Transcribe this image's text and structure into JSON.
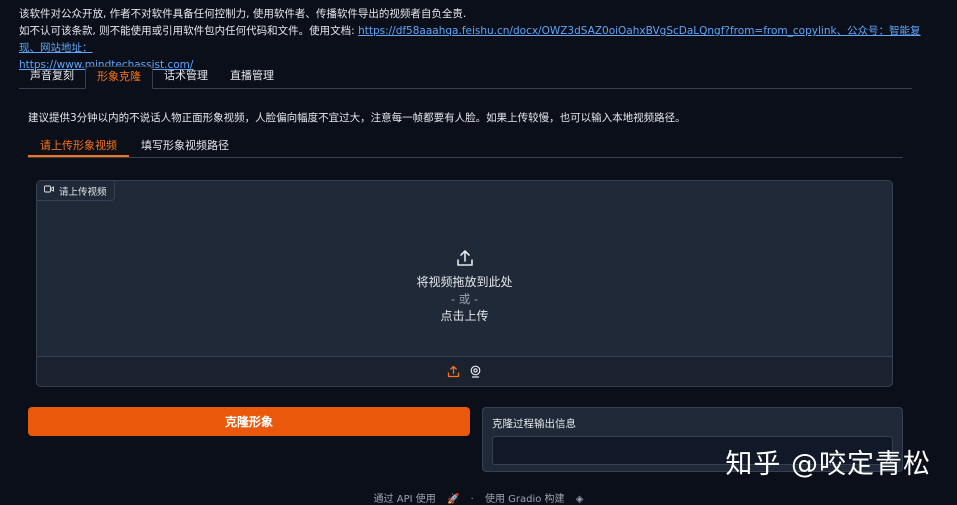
{
  "notice": {
    "line1": "该软件对公众开放, 作者不对软件具备任何控制力, 使用软件者、传播软件导出的视频者自负全责.",
    "line2_prefix": "如不认可该条款, 则不能使用或引用软件包内任何代码和文件。使用文档:",
    "doc_link": "https://df58aaahqa.feishu.cn/docx/OWZ3dSAZ0oiOahxBVgScDaLQngf?from=from_copylink",
    "public_account": "、公众号：智能复现、网站地址：",
    "site_link": "https://www.mindtechassist.com/"
  },
  "tabs": [
    {
      "label": "声音复刻",
      "active": false
    },
    {
      "label": "形象克隆",
      "active": true
    },
    {
      "label": "话术管理",
      "active": false
    },
    {
      "label": "直播管理",
      "active": false
    }
  ],
  "hint": "建议提供3分钟以内的不说话人物正面形象视频，人脸偏向幅度不宜过大，注意每一帧都要有人脸。如果上传较慢，也可以输入本地视频路径。",
  "subtabs": [
    {
      "label": "请上传形象视频",
      "active": true
    },
    {
      "label": "填写形象视频路径",
      "active": false
    }
  ],
  "upload": {
    "label": "请上传视频",
    "drop_text": "将视频拖放到此处",
    "or_text": "- 或 -",
    "click_text": "点击上传"
  },
  "clone_button": "克隆形象",
  "output": {
    "label": "克隆过程输出信息",
    "value": ""
  },
  "footer": {
    "api": "通过 API 使用",
    "sep": "·",
    "gradio": "使用 Gradio 构建"
  },
  "watermark": "知乎 @咬定青松",
  "colors": {
    "accent": "#f97316",
    "button": "#ea580c",
    "background": "#0b0f19",
    "panel": "#1f2937",
    "link": "#60a5fa"
  }
}
